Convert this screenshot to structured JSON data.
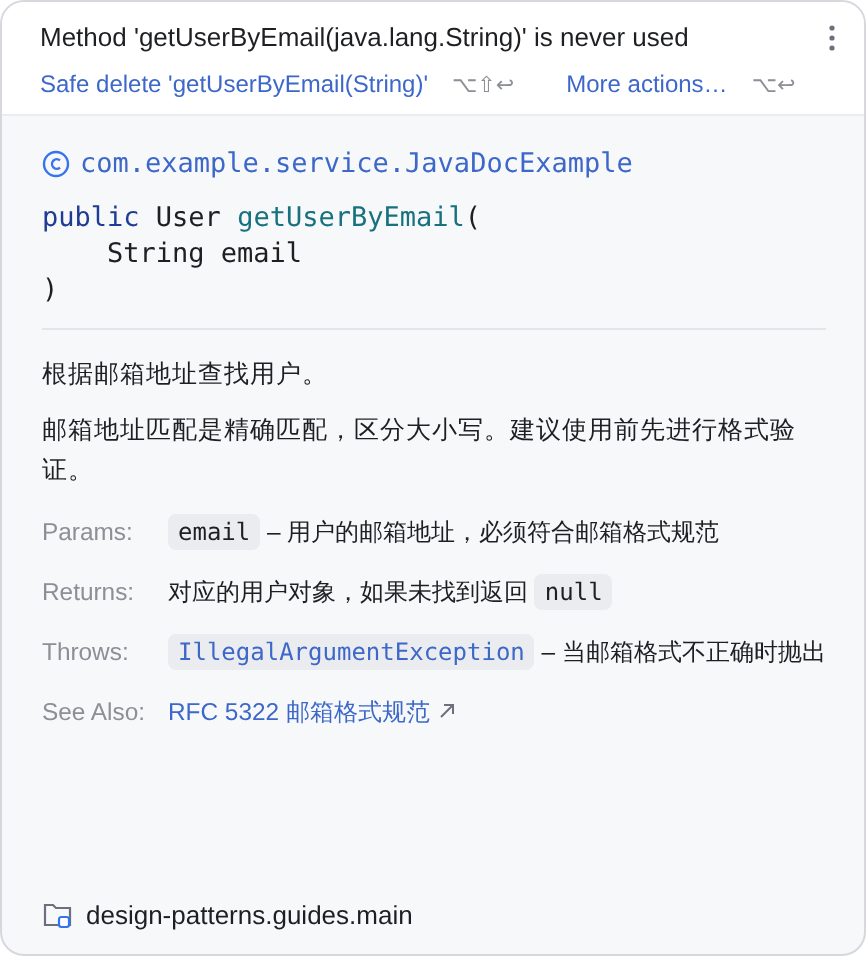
{
  "inspection": {
    "message": "Method 'getUserByEmail(java.lang.String)' is never used",
    "actions": [
      {
        "label": "Safe delete 'getUserByEmail(String)'",
        "shortcut": "⌥⇧↩"
      },
      {
        "label": "More actions…",
        "shortcut": "⌥↩"
      }
    ]
  },
  "doc": {
    "class_name": "com.example.service.JavaDocExample",
    "signature": [
      [
        {
          "kind": "keyword",
          "text": "public"
        },
        {
          "kind": "plain",
          "text": " User "
        },
        {
          "kind": "method",
          "text": "getUserByEmail"
        },
        {
          "kind": "plain",
          "text": "("
        }
      ],
      [
        {
          "kind": "plain",
          "text": "    String email"
        }
      ],
      [
        {
          "kind": "plain",
          "text": ")"
        }
      ]
    ],
    "paragraphs": [
      "根据邮箱地址查找用户。",
      "邮箱地址匹配是精确匹配，区分大小写。建议使用前先进行格式验证。"
    ],
    "sections": [
      {
        "label": "Params:",
        "parts": [
          {
            "kind": "code",
            "text": "email"
          },
          {
            "kind": "text",
            "text": " – 用户的邮箱地址，必须符合邮箱格式规范"
          }
        ]
      },
      {
        "label": "Returns:",
        "parts": [
          {
            "kind": "text",
            "text": "对应的用户对象，如果未找到返回 "
          },
          {
            "kind": "code",
            "text": "null"
          }
        ]
      },
      {
        "label": "Throws:",
        "parts": [
          {
            "kind": "codelink",
            "text": "IllegalArgumentException"
          },
          {
            "kind": "text",
            "text": " – 当邮箱格式不正确时抛出"
          }
        ]
      },
      {
        "label": "See Also:",
        "parts": [
          {
            "kind": "link",
            "text": "RFC 5322 邮箱格式规范"
          }
        ]
      }
    ]
  },
  "footer": {
    "module": "design-patterns.guides.main"
  }
}
